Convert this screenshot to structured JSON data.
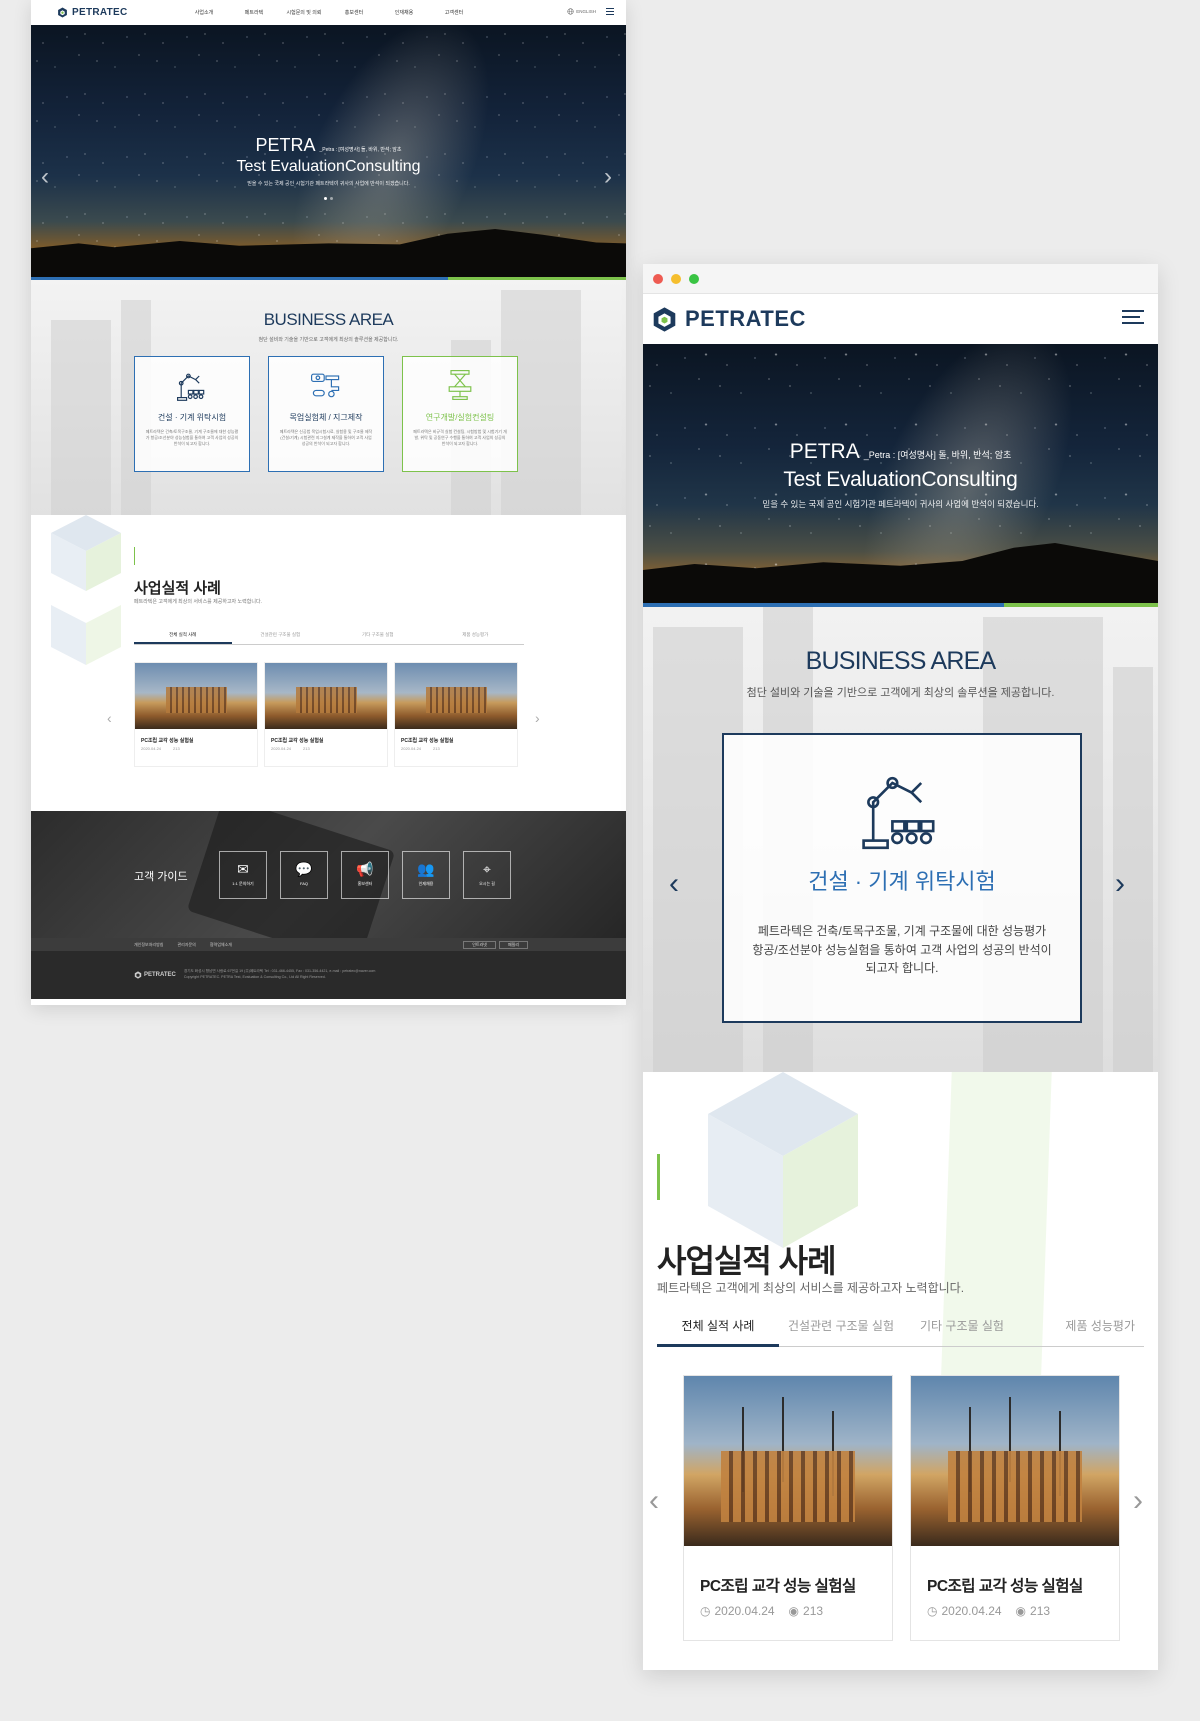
{
  "brand": {
    "name": "PETRATEC",
    "navy": "#1d3a5c",
    "blue": "#2d6fb3",
    "green": "#7dc24b"
  },
  "desktop": {
    "nav": [
      "사업소개",
      "페트라텍",
      "시험문의 및 의뢰",
      "홍보센터",
      "인재채용",
      "고객센터"
    ],
    "lang": "ENGLISH",
    "hero": {
      "title": "PETRA",
      "title_note": "_Petra : [여성명사] 돌, 바위, 반석; 암초",
      "subtitle": "Test EvaluationConsulting",
      "desc": "믿을 수 있는 국제 공인 시험기관 페트라텍이 귀사의 사업에 반석이 되겠습니다."
    },
    "business": {
      "title": "BUSINESS AREA",
      "sub": "첨단 설비와 기술을 기반으로 고객에게 최상의 솔루션을 제공합니다.",
      "cards": [
        {
          "title": "건설 · 기계 위탁시험",
          "desc": "페트라텍은 건축/토목구조물, 기계 구조물에 대한 성능평가 항공/조선분야 성능실험을 통하여 고객 사업의 성공의 반석이 되고자 합니다."
        },
        {
          "title": "목업실험체 / 지그제작",
          "desc": "페트라텍은 신공법 목업시험시료, 실험용 및 구조물 제작(건설/기계) 시험관련 지그설계 제작을 통하여 고객 사업 성공의 반석이 되고자 합니다."
        },
        {
          "title": "연구개발/실험컨설팅",
          "desc": "페트라텍은 비규격 실험 컨설팅, 시험방법 및 시험기기 개발, 위탁 및 공동연구 수행을 통하여 고객 사업의 성공의 반석이 되고자 합니다."
        }
      ]
    },
    "cases": {
      "title": "사업실적 사례",
      "sub": "페트라텍은 고객에게 최상의 서비스를 제공하고자 노력합니다.",
      "tabs": [
        "전체 실적 사례",
        "건설관련 구조물 실험",
        "기타 구조물 실험",
        "제품 성능평가"
      ],
      "items": [
        {
          "title": "PC조립 교각 성능 실험실",
          "date": "2020.04.24",
          "views": "213"
        },
        {
          "title": "PC조립 교각 성능 실험실",
          "date": "2020.04.24",
          "views": "213"
        },
        {
          "title": "PC조립 교각 성능 실험실",
          "date": "2020.04.24",
          "views": "213"
        }
      ]
    },
    "guide": {
      "label": "고객 가이드",
      "buttons": [
        {
          "label": "1:1 문의하기",
          "icon": "mail-icon"
        },
        {
          "label": "FAQ",
          "icon": "chat-icon"
        },
        {
          "label": "홍보센터",
          "icon": "megaphone-icon"
        },
        {
          "label": "인재채용",
          "icon": "people-icon"
        },
        {
          "label": "오시는 길",
          "icon": "map-pin-icon"
        }
      ]
    },
    "footer_links": [
      "개인정보처리방침",
      "관리자문의",
      "협력업체소개"
    ],
    "footer_selects": [
      "인트라넷",
      "패밀리"
    ],
    "footer": {
      "address": "경기도 화성시 향남면 사랑로 67번길 19 (주)페트라텍   Tel : 031-466-4455,  Fax : 031-356-4421,  e-mail : petratec@naver.com",
      "copyright": "Copyright PETRATEC. PETRA Test, Evaluation & Consulting Co., Ltd All Right Reserved."
    }
  },
  "mobile": {
    "hero": {
      "title": "PETRA",
      "title_note": "_Petra : [여성명사] 돌, 바위, 반석; 암초",
      "subtitle": "Test EvaluationConsulting",
      "desc": "믿을 수 있는 국제 공인 시험기관 페트라텍이 귀사의 사업에 반석이 되겠습니다."
    },
    "business": {
      "title": "BUSINESS AREA",
      "sub": "첨단 설비와 기술을 기반으로 고객에게 최상의 솔루션을 제공합니다.",
      "card": {
        "title": "건설 · 기계 위탁시험",
        "desc": "페트라텍은 건축/토목구조물, 기계 구조물에 대한 성능평가 항공/조선분야 성능실험을 통하여 고객 사업의 성공의 반석이 되고자 합니다."
      }
    },
    "cases": {
      "title": "사업실적 사례",
      "sub": "페트라텍은 고객에게 최상의 서비스를 제공하고자 노력합니다.",
      "tabs": [
        "전체 실적 사례",
        "건설관련 구조물 실험",
        "기타 구조물 실험",
        "제품 성능평가"
      ],
      "items": [
        {
          "title": "PC조립 교각 성능 실험실",
          "date": "2020.04.24",
          "views": "213"
        },
        {
          "title": "PC조립 교각 성능 실험실",
          "date": "2020.04.24",
          "views": "213"
        }
      ]
    }
  }
}
